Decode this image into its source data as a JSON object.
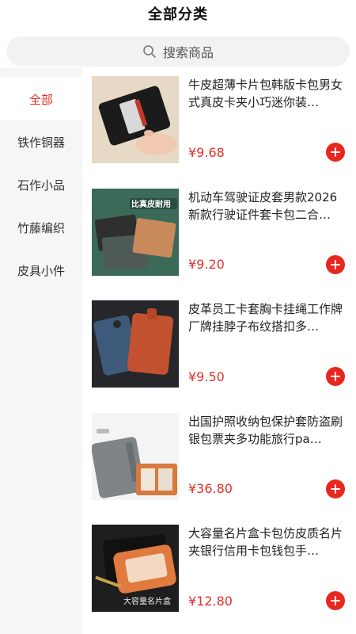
{
  "header": {
    "title": "全部分类"
  },
  "search": {
    "placeholder": "搜索商品"
  },
  "sidebar": {
    "items": [
      {
        "label": "全部",
        "active": true
      },
      {
        "label": "铁作铜器",
        "active": false
      },
      {
        "label": "石作小品",
        "active": false
      },
      {
        "label": "竹藤编织",
        "active": false
      },
      {
        "label": "皮具小件",
        "active": false
      }
    ]
  },
  "products": [
    {
      "name": "牛皮超薄卡片包韩版卡包男女式真皮卡夹小巧迷你装…",
      "price": "¥9.68"
    },
    {
      "name": "机动车驾驶证皮套男款2026新款行驶证件套卡包二合…",
      "price": "¥9.20",
      "image_text": "比真皮耐用"
    },
    {
      "name": "皮革员工卡套胸卡挂绳工作牌厂牌挂脖子布纹搭扣多…",
      "price": "¥9.50"
    },
    {
      "name": "出国护照收纳包保护套防盗刷银包票夹多功能旅行pa…",
      "price": "¥36.80"
    },
    {
      "name": "大容量名片盒卡包仿皮质名片夹银行信用卡包钱包手…",
      "price": "¥12.80",
      "image_text": "大容量名片盒"
    }
  ],
  "colors": {
    "accent": "#e0312a",
    "sidebar_bg": "#f6f6f6",
    "search_bg": "#f2f2f2"
  },
  "icons": {
    "search": "search-icon",
    "add": "plus-icon"
  }
}
